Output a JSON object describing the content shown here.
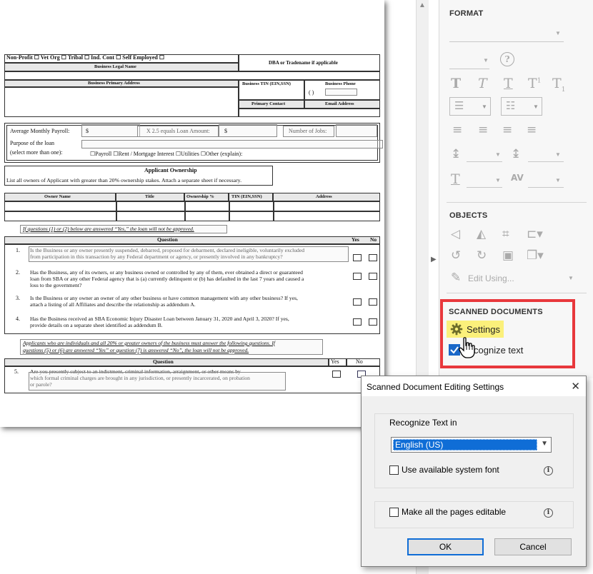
{
  "document": {
    "applicant_types": "Non-Profit ☐ Vet Org ☐ Tribal ☐ Ind. Cont ☐ Self Employed ☐",
    "business_legal_name": "Business Legal Name",
    "dba": "DBA or Tradename if applicable",
    "primary_address": "Business Primary Address",
    "tin": "Business TIN (EIN,SSN)",
    "phone_label": "Business Phone",
    "phone_placeholder": "(     )",
    "primary_contact": "Primary Contact",
    "email": "Email Address",
    "avg_payroll": "Average Monthly Payroll:",
    "dollar": "$",
    "x25": "X 2.5 equals Loan Amount:",
    "num_jobs": "Number of Jobs:",
    "purpose": "Purpose of the loan",
    "select_more": "(select more than one):",
    "purposes": "☐Payroll  ☐Rent / Mortgage Interest  ☐Utilities  ☐Other (explain):",
    "ownership_title": "Applicant Ownership",
    "ownership_desc": "List all owners of Applicant with greater than 20% ownership stakes. Attach a separate sheet if necessary.",
    "owner_cols": [
      "Owner Name",
      "Title",
      "Ownership %",
      "TIN (EIN,SSN)",
      "Address"
    ],
    "warning1": "If questions (1) or (2) below are answered “Yes,” the loan will not be approved.",
    "question_hdr": "Question",
    "yes": "Yes",
    "no": "No",
    "questions": [
      {
        "n": "1.",
        "l1": "Is the Business or any owner presently suspended, debarred, proposed for debarment, declared ineligible, voluntarily excluded",
        "l2": "from participation in this transaction by any Federal department or agency, or presently involved in any bankruptcy?",
        "l3": ""
      },
      {
        "n": "2.",
        "l1": "Has the Business, any of its owners, or any business owned or controlled by any of them, ever obtained a direct or guaranteed",
        "l2": "loan from SBA or any other Federal agency that is (a) currently delinquent or (b) has defaulted in the last 7 years and caused a",
        "l3": "loss to the government?"
      },
      {
        "n": "3.",
        "l1": "Is the Business or any owner an owner of any other business or have common management with any other business? If yes,",
        "l2": "attach a listing of all Affiliates and describe the relationship as addendum A.",
        "l3": ""
      },
      {
        "n": "4.",
        "l1": "Has the Business received an SBA Economic Injury Disaster Loan between January 31, 2020 and April 3, 2020? If yes,",
        "l2": "provide details on a separate sheet identified as addendum B.",
        "l3": ""
      }
    ],
    "warning2_l1": "Applicants who are individuals and all 20% or greater owners of the business must answer the following questions. If",
    "warning2_l2": "questions (5) or (6) are answered “Yes” or question (7) is answered “No”, the loan will not be approved.",
    "q5": {
      "n": "5.",
      "l1": "Are you presently subject to an indictment, criminal information, arraignment, or other means by",
      "l2": "which formal criminal charges are brought in any jurisdiction, or presently incarcerated, on probation",
      "l3": "or parole?"
    }
  },
  "panel": {
    "format_title": "FORMAT",
    "objects_title": "OBJECTS",
    "edit_using": "Edit Using...",
    "scanned_title": "SCANNED DOCUMENTS",
    "settings_label": "Settings",
    "recognize_text": "cognize text"
  },
  "dialog": {
    "title": "Scanned Document Editing Settings",
    "close_glyph": "✕",
    "recognize_in": "Recognize Text in",
    "language": "English (US)",
    "use_system_font": "Use available system font",
    "make_all_editable": "Make all the pages editable",
    "info_glyph": "i",
    "ok": "OK",
    "cancel": "Cancel"
  },
  "colors": {
    "highlight_border": "#e8383c",
    "settings_bg": "#fbf07b",
    "accent": "#0f6dd6"
  },
  "icons": [
    "gear-icon",
    "hand-cursor-icon",
    "checkbox-checked-icon",
    "help-icon",
    "info-icon",
    "close-icon"
  ]
}
